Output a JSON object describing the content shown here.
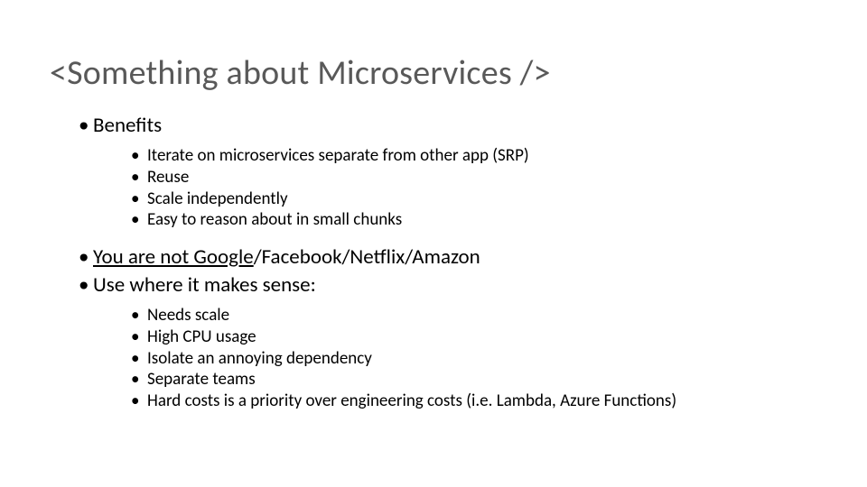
{
  "slide": {
    "title": "<Something about Microservices />",
    "section1": {
      "heading": "Benefits",
      "items": [
        "Iterate on microservices separate from other app (SRP)",
        "Reuse",
        "Scale independently",
        "Easy to reason about in small chunks"
      ]
    },
    "link": {
      "text": "You are not Google",
      "rest": "/Facebook/Netflix/Amazon"
    },
    "section2": {
      "heading": "Use where it makes sense:",
      "items": [
        "Needs scale",
        "High CPU usage",
        "Isolate an annoying dependency",
        "Separate teams",
        "Hard costs is a priority over engineering costs (i.e. Lambda, Azure Functions)"
      ]
    }
  }
}
